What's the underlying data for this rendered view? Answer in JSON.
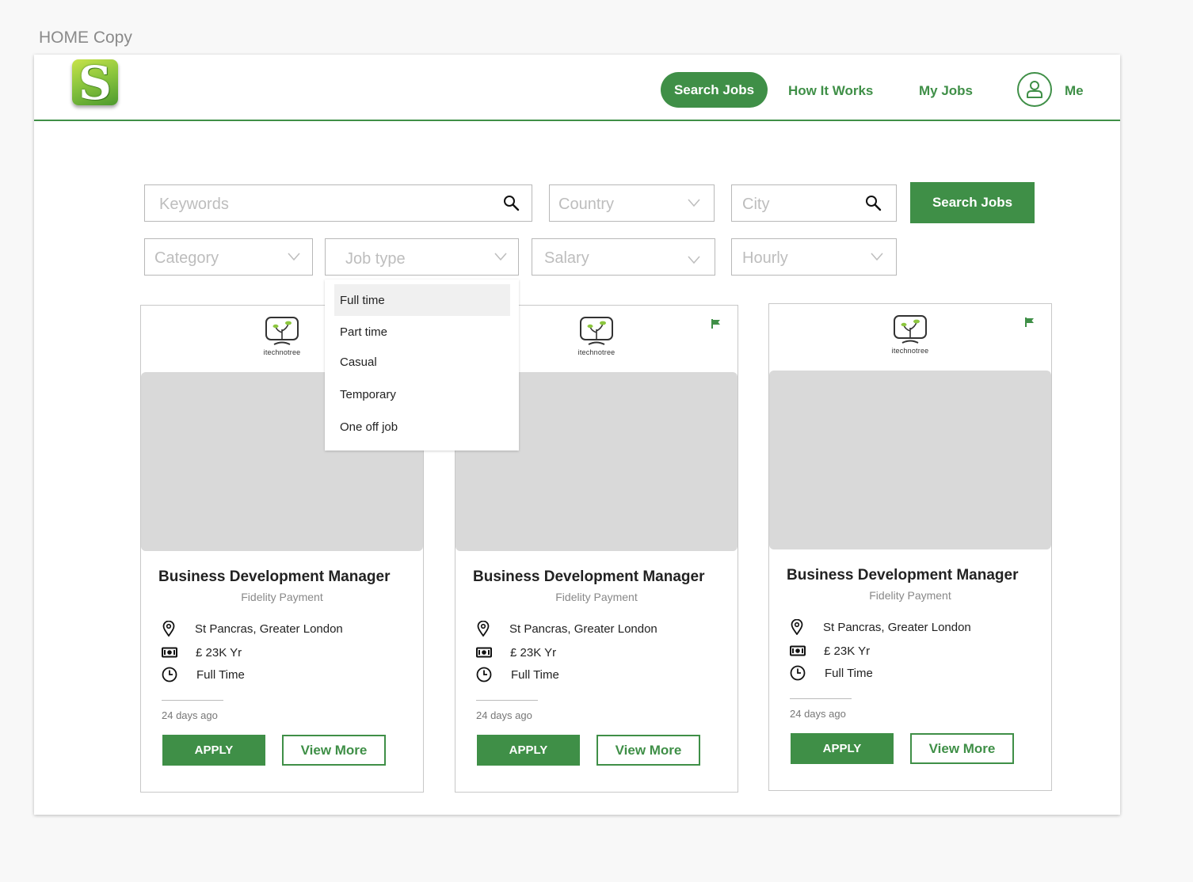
{
  "artboard": {
    "label": "HOME Copy"
  },
  "header": {
    "logo_letter": "S",
    "nav": {
      "search_jobs": "Search Jobs",
      "how_it_works": "How It Works",
      "my_jobs": "My Jobs",
      "me": "Me"
    }
  },
  "search": {
    "keywords_placeholder": "Keywords",
    "country_placeholder": "Country",
    "city_placeholder": "City",
    "button_label": "Search Jobs"
  },
  "filters": {
    "category": "Category",
    "job_type": "Job type",
    "salary": "Salary",
    "hourly": "Hourly"
  },
  "job_type_dropdown": {
    "selected": "Full time",
    "options": [
      "Full time",
      "Part time",
      "Casual",
      "Temporary",
      "One off job"
    ]
  },
  "jobs": [
    {
      "brand": "itechnotree",
      "title": "Business Development Manager",
      "company": "Fidelity Payment",
      "location": "St Pancras, Greater London",
      "salary": "£ 23K Yr",
      "type": "Full Time",
      "posted": "24 days ago",
      "apply": "APPLY",
      "view_more": "View More",
      "flagged": false
    },
    {
      "brand": "itechnotree",
      "title": "Business Development Manager",
      "company": "Fidelity Payment",
      "location": "St Pancras, Greater London",
      "salary": "£ 23K Yr",
      "type": "Full Time",
      "posted": "24 days ago",
      "apply": "APPLY",
      "view_more": "View More",
      "flagged": true
    },
    {
      "brand": "itechnotree",
      "title": "Business Development Manager",
      "company": "Fidelity Payment",
      "location": "St Pancras, Greater London",
      "salary": "£ 23K Yr",
      "type": "Full Time",
      "posted": "24 days ago",
      "apply": "APPLY",
      "view_more": "View More",
      "flagged": true
    }
  ],
  "icons": {
    "search": "magnifier-icon",
    "dropdown": "chevron-down-icon",
    "location": "map-pin-icon",
    "salary": "banknote-icon",
    "time": "clock-icon",
    "flag": "flag-icon",
    "user": "user-icon"
  },
  "colors": {
    "accent": "#3f8f47",
    "placeholder": "#bdbdbd",
    "media": "#d9d9d9"
  }
}
